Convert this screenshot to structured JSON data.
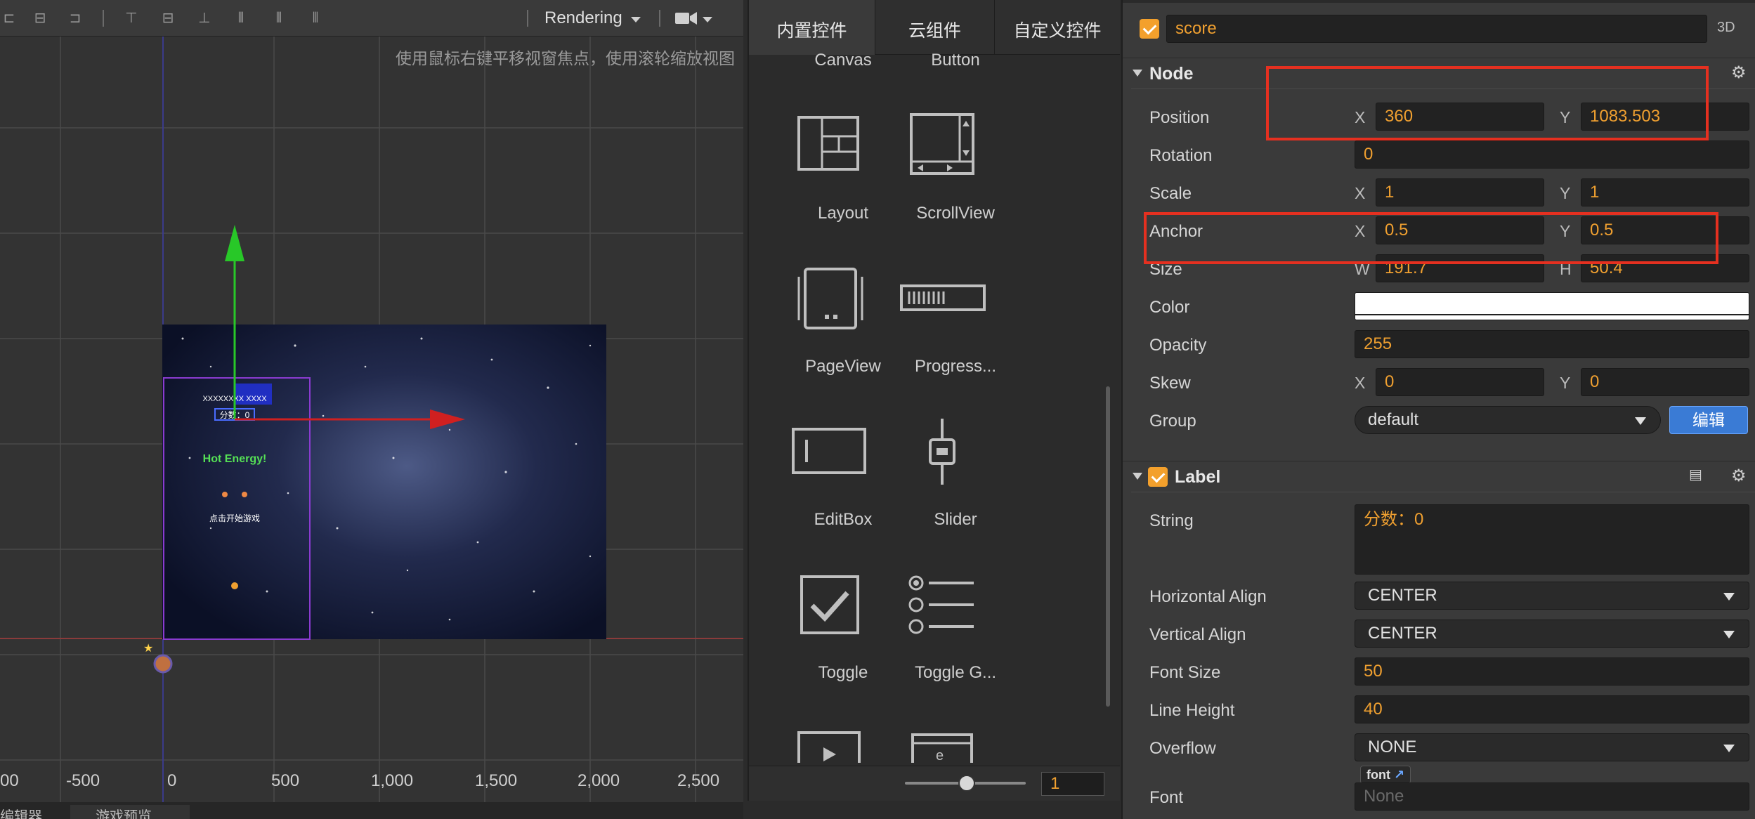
{
  "scene": {
    "render_mode": "Rendering",
    "hint": "使用鼠标右键平移视窗焦点，使用滚轮缩放视图",
    "axis_labels": [
      "00",
      "-500",
      "0",
      "500",
      "1,000",
      "1,500",
      "2,000",
      "2,500"
    ],
    "bottom_tabs": [
      "编辑器",
      "游戏预览"
    ],
    "game_preview_texts": {
      "title": "Hot Energy!",
      "line1": "分数：0",
      "line2": "点击开始游戏"
    }
  },
  "widgets_panel": {
    "tabs": [
      "内置控件",
      "云组件",
      "自定义控件"
    ],
    "items": [
      {
        "label": "Canvas",
        "icon": "canvas-icon"
      },
      {
        "label": "Button",
        "icon": "button-icon"
      },
      {
        "label": "Layout",
        "icon": "layout-icon"
      },
      {
        "label": "ScrollView",
        "icon": "scrollview-icon"
      },
      {
        "label": "PageView",
        "icon": "pageview-icon"
      },
      {
        "label": "Progress...",
        "icon": "progressbar-icon"
      },
      {
        "label": "EditBox",
        "icon": "editbox-icon"
      },
      {
        "label": "Slider",
        "icon": "slider-icon"
      },
      {
        "label": "Toggle",
        "icon": "toggle-icon"
      },
      {
        "label": "Toggle G...",
        "icon": "toggle-group-icon"
      }
    ],
    "zoom_value": "1"
  },
  "inspector": {
    "node_name": "score",
    "mode_3d": "3D",
    "node_section": {
      "title": "Node",
      "position": {
        "label": "Position",
        "x": "360",
        "y": "1083.503"
      },
      "rotation": {
        "label": "Rotation",
        "value": "0"
      },
      "scale": {
        "label": "Scale",
        "x": "1",
        "y": "1"
      },
      "anchor": {
        "label": "Anchor",
        "x": "0.5",
        "y": "0.5"
      },
      "size": {
        "label": "Size",
        "w": "191.7",
        "h": "50.4"
      },
      "color": {
        "label": "Color",
        "value": "#ffffff"
      },
      "opacity": {
        "label": "Opacity",
        "value": "255"
      },
      "skew": {
        "label": "Skew",
        "x": "0",
        "y": "0"
      },
      "group": {
        "label": "Group",
        "value": "default",
        "edit_label": "编辑"
      }
    },
    "label_section": {
      "title": "Label",
      "string": {
        "label": "String",
        "value": "分数：0"
      },
      "h_align": {
        "label": "Horizontal Align",
        "value": "CENTER"
      },
      "v_align": {
        "label": "Vertical Align",
        "value": "CENTER"
      },
      "font_size": {
        "label": "Font Size",
        "value": "50"
      },
      "line_height": {
        "label": "Line Height",
        "value": "40"
      },
      "overflow": {
        "label": "Overflow",
        "value": "NONE"
      },
      "font": {
        "label": "Font",
        "tag": "font",
        "value": "None"
      }
    },
    "axis_x": "X",
    "axis_y": "Y",
    "axis_w": "W",
    "axis_h": "H",
    "highlight_color": "#e53020",
    "accent_color": "#f0a030"
  }
}
